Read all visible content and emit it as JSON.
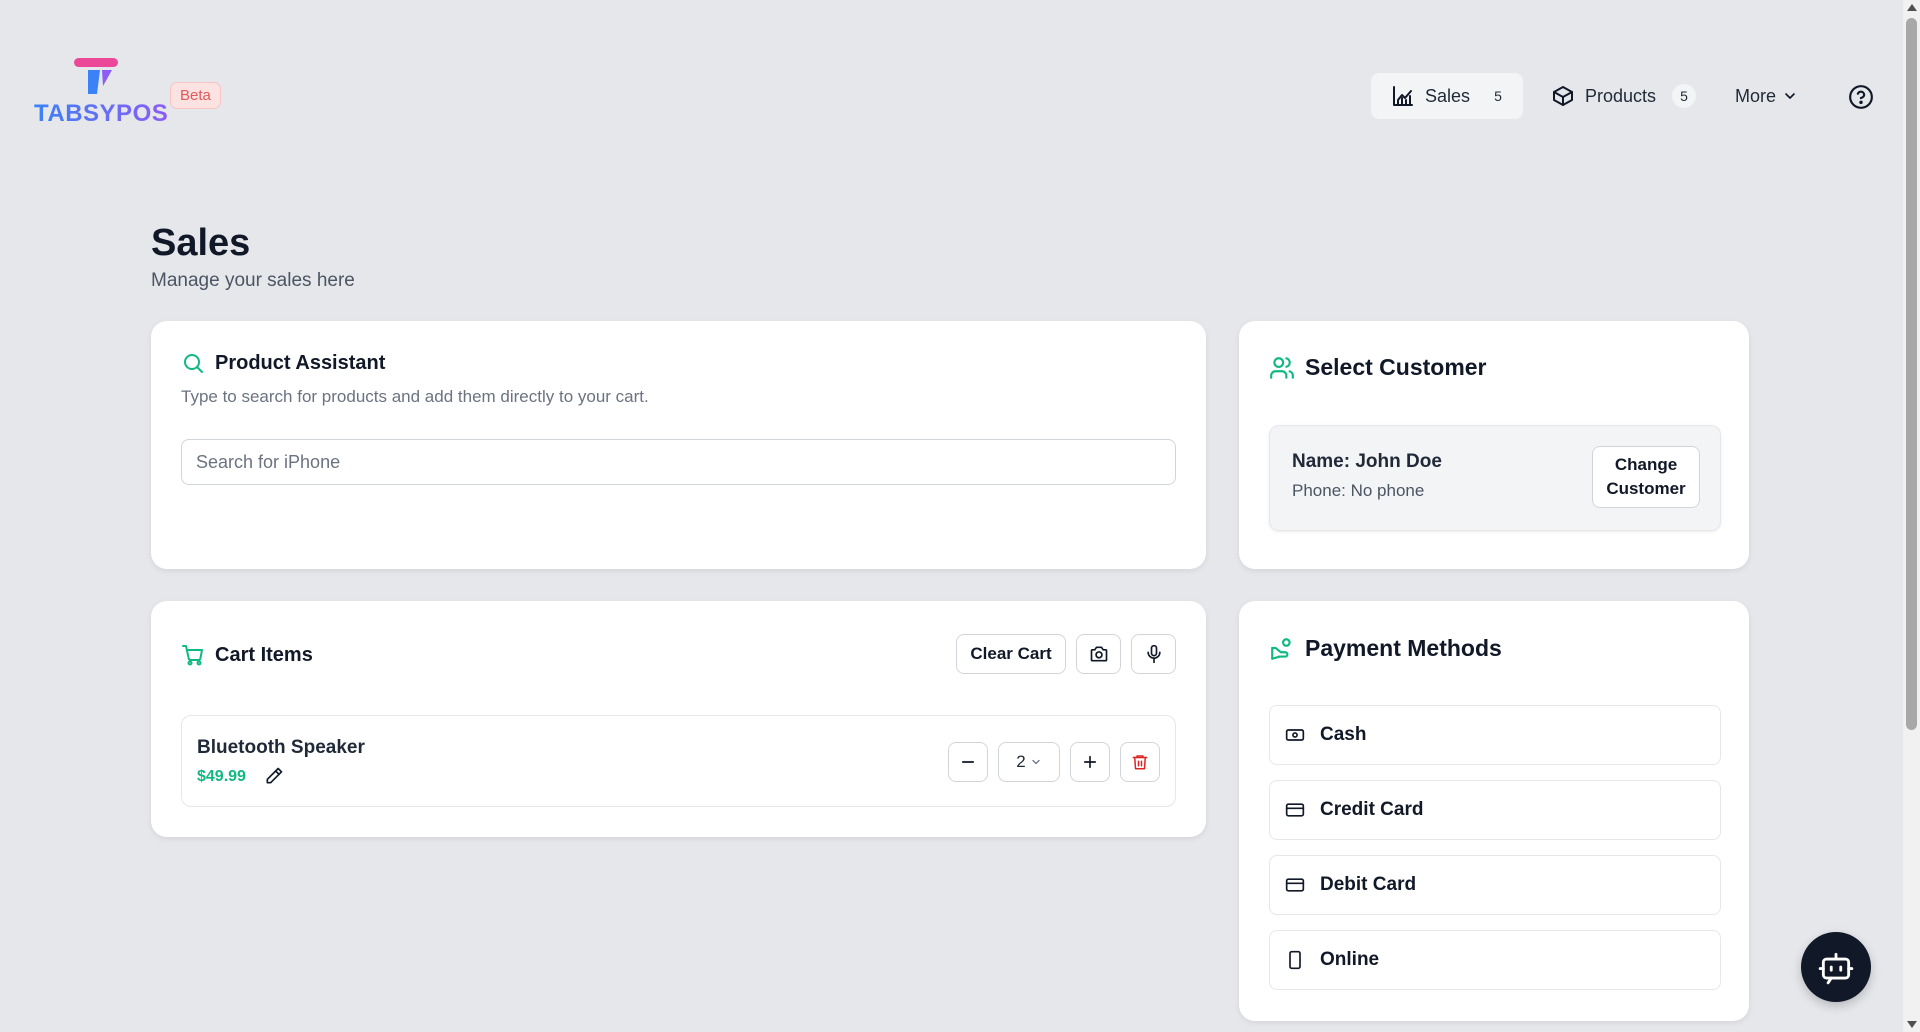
{
  "header": {
    "logo_text": "TABSYPOS",
    "beta_badge": "Beta",
    "nav": [
      {
        "label": "Sales",
        "count": "5",
        "icon": "chart-line-icon",
        "active": true
      },
      {
        "label": "Products",
        "count": "5",
        "icon": "box-icon",
        "active": false
      },
      {
        "label": "More",
        "icon": "chevron-down-icon",
        "active": false
      }
    ],
    "help_icon": "help-circle-icon"
  },
  "page": {
    "title": "Sales",
    "subtitle": "Manage your sales here"
  },
  "product_assistant": {
    "title": "Product Assistant",
    "description": "Type to search for products and add them directly to your cart.",
    "search_placeholder": "Search for iPhone",
    "search_value": ""
  },
  "customer": {
    "title": "Select Customer",
    "name_line": "Name: John Doe",
    "phone_line": "Phone: No phone",
    "change_button_line1": "Change",
    "change_button_line2": "Customer"
  },
  "cart": {
    "title": "Cart Items",
    "clear_button": "Clear Cart",
    "items": [
      {
        "name": "Bluetooth Speaker",
        "price": "$49.99",
        "quantity": "2"
      }
    ]
  },
  "payment": {
    "title": "Payment Methods",
    "methods": [
      {
        "label": "Cash",
        "icon": "banknote-icon"
      },
      {
        "label": "Credit Card",
        "icon": "credit-card-icon"
      },
      {
        "label": "Debit Card",
        "icon": "credit-card-icon"
      },
      {
        "label": "Online",
        "icon": "smartphone-icon"
      }
    ]
  },
  "colors": {
    "accent_green": "#10b981",
    "danger_red": "#dc2626",
    "logo_pink": "#ec4899",
    "logo_blue": "#3b82f6",
    "background": "#e5e7eb"
  }
}
